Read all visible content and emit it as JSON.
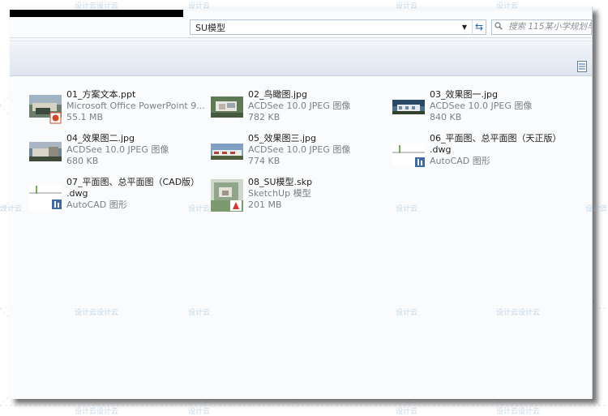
{
  "address_bar": {
    "path": "SU模型"
  },
  "search": {
    "placeholder": "搜索 115某小学规划与设"
  },
  "files": [
    {
      "name": "01_方案文本.ppt",
      "type": "Microsoft Office PowerPoint 9...",
      "size": "55.1 MB",
      "thumb": "ppt"
    },
    {
      "name": "02_鸟瞰图.jpg",
      "type": "ACDSee 10.0 JPEG 图像",
      "size": "782 KB",
      "thumb": "aerial"
    },
    {
      "name": "03_效果图一.jpg",
      "type": "ACDSee 10.0 JPEG 图像",
      "size": "840 KB",
      "thumb": "render"
    },
    {
      "name": "04_效果图二.jpg",
      "type": "ACDSee 10.0 JPEG 图像",
      "size": "680 KB",
      "thumb": "render2"
    },
    {
      "name": "05_效果图三.jpg",
      "type": "ACDSee 10.0 JPEG 图像",
      "size": "774 KB",
      "thumb": "render3"
    },
    {
      "name": "06_平面图、总平面图（天正版）",
      "name2": ".dwg",
      "type": "AutoCAD 图形",
      "thumb": "dwg"
    },
    {
      "name": "07_平面图、总平面图（CAD版）",
      "name2": ".dwg",
      "type": "AutoCAD 图形",
      "thumb": "dwg"
    },
    {
      "name": "08_SU模型.skp",
      "type": "SketchUp 模型",
      "size": "201 MB",
      "thumb": "skp"
    }
  ],
  "watermark": {
    "text": "设计云",
    "pair": "设计云设计云"
  },
  "colors": {
    "accent": "#2b5fa8",
    "text": "#1e1e1e",
    "meta": "#7a7f86"
  }
}
